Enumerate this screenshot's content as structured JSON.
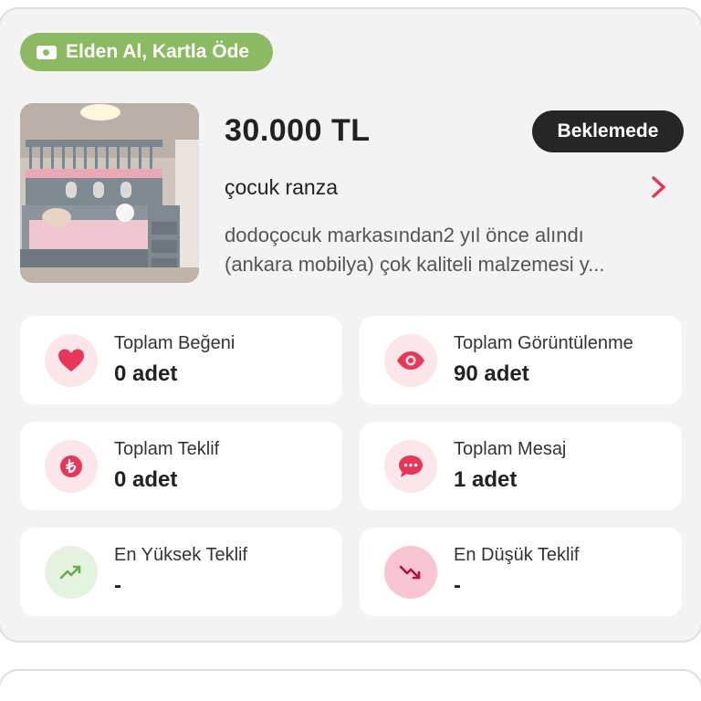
{
  "listing": {
    "delivery_badge": "Elden Al, Kartla Öde",
    "price": "30.000 TL",
    "status": "Beklemede",
    "title": "çocuk ranza",
    "description_line1": "dodoçocuk markasından2 yıl önce alındı",
    "description_line2": "(ankara mobilya) çok kaliteli malzemesi y...",
    "photo_icon": "bunk-bed-photo"
  },
  "stats": [
    {
      "label": "Toplam Beğeni",
      "value": "0 adet",
      "icon": "heart-icon"
    },
    {
      "label": "Toplam Görüntülenme",
      "value": "90 adet",
      "icon": "eye-icon"
    },
    {
      "label": "Toplam Teklif",
      "value": "0 adet",
      "icon": "lira-icon"
    },
    {
      "label": "Toplam Mesaj",
      "value": "1 adet",
      "icon": "message-icon"
    },
    {
      "label": "En Yüksek Teklif",
      "value": "-",
      "icon": "trend-up-icon"
    },
    {
      "label": "En Düşük Teklif",
      "value": "-",
      "icon": "trend-down-icon"
    }
  ],
  "colors": {
    "accent": "#e8355a",
    "badge_green": "#8cba62",
    "status_dark": "#262626",
    "trend_green": "#6aab4a"
  }
}
